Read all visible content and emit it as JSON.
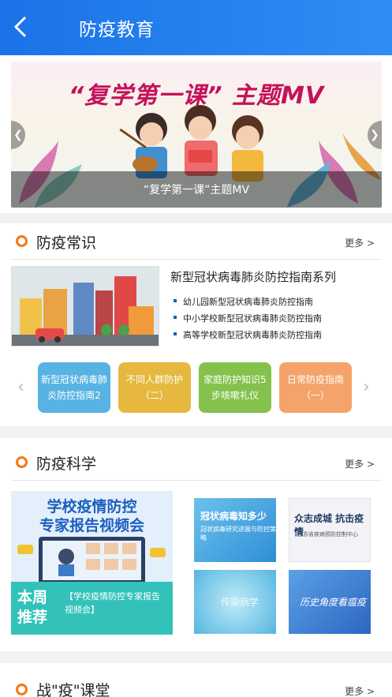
{
  "header": {
    "title": "防疫教育",
    "back_icon": "chevron-left-icon"
  },
  "banner": {
    "heading": "“复学第一课” 主题MV",
    "caption": "“复学第一课”主题MV"
  },
  "knowledge": {
    "title": "防疫常识",
    "more": "更多 >",
    "guide_title": "新型冠状病毒肺炎防控指南系列",
    "guide_items": [
      "幼儿园新型冠状病毒肺炎防控指南",
      "中小学校新型冠状病毒肺炎防控指南",
      "高等学校新型冠状病毒肺炎防控指南"
    ],
    "pills": [
      {
        "label": "新型冠状病毒肺炎防控指南2",
        "color": "#57b3e3"
      },
      {
        "label": "不同人群防护（二）",
        "color": "#e6b83f"
      },
      {
        "label": "家庭防护知识5步咳嗽礼仪",
        "color": "#84c24d"
      },
      {
        "label": "日常防疫指南（一）",
        "color": "#f4a46a"
      }
    ]
  },
  "science": {
    "title": "防疫科学",
    "more": "更多 >",
    "expert_heading_line1": "学校疫情防控",
    "expert_heading_line2": "专家报告视频会",
    "expert_tag_line1": "本周",
    "expert_tag_line2": "推荐",
    "expert_desc": "【学校疫情防控专家报告视频会】",
    "thumbs": [
      {
        "text": "冠状病毒知多少",
        "sub": "冠状病毒研究进展与防控策略",
        "bg": "#4aa8e0"
      },
      {
        "text": "众志成城 抗击疫情",
        "sub": "江苏省疾病预防控制中心",
        "bg": "#f1f3f6"
      },
      {
        "text": "传染病学",
        "sub": "",
        "bg": "#6cc6e8"
      },
      {
        "text": "历史角度看瘟疫",
        "sub": "",
        "bg": "#3a7fd6"
      }
    ]
  },
  "classroom": {
    "title": "战\"疫\"课堂",
    "more": "更多 >"
  }
}
